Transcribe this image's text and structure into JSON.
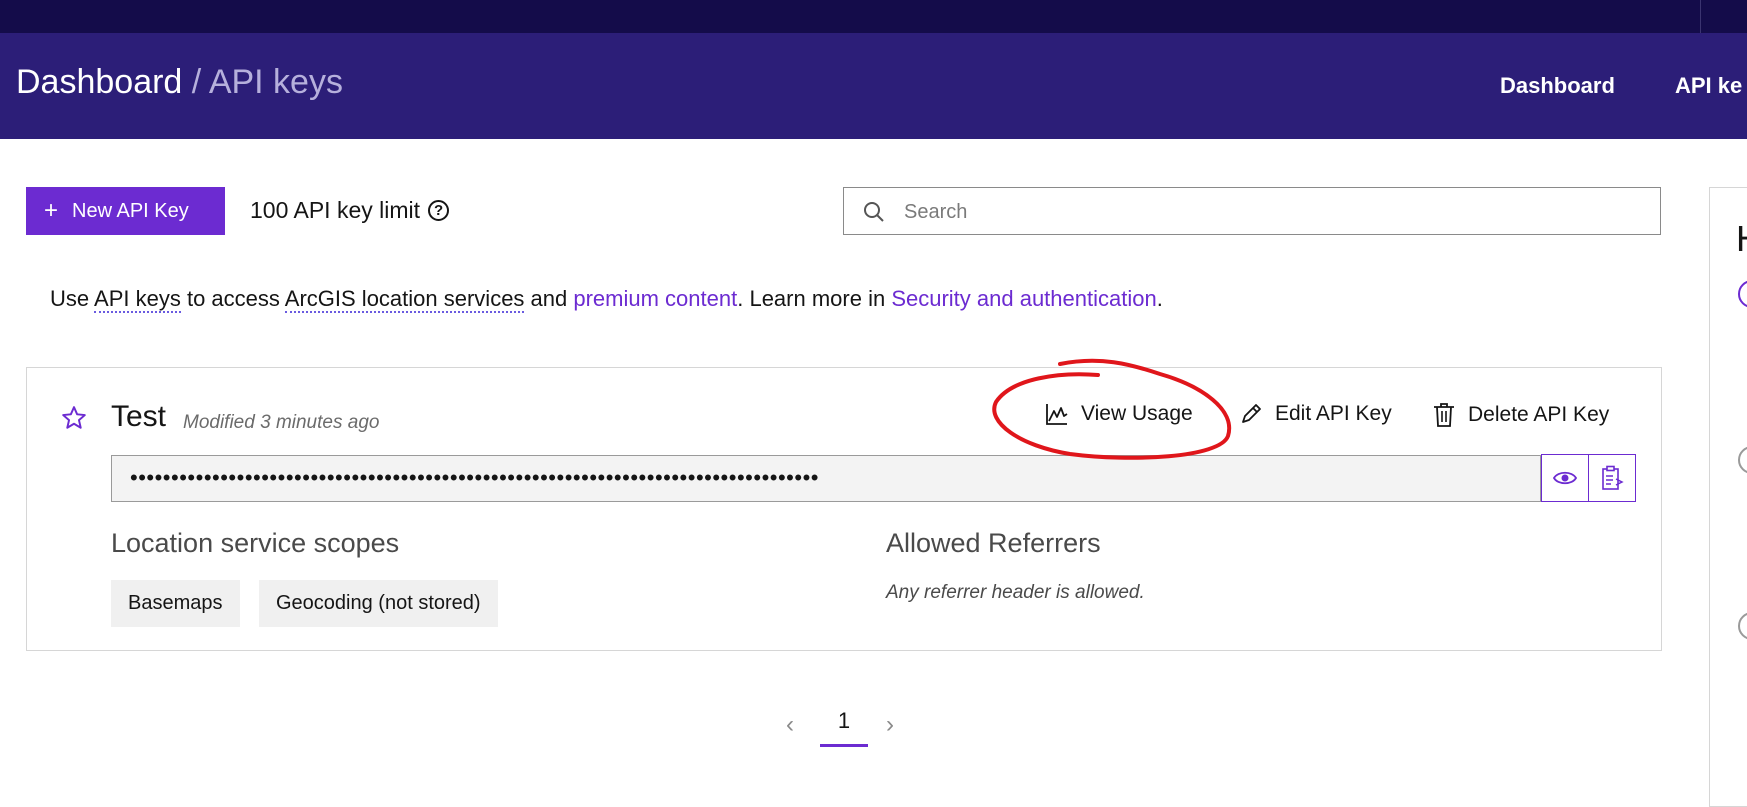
{
  "header": {
    "breadcrumb_root": "Dashboard",
    "breadcrumb_sep": " / ",
    "breadcrumb_current": "API keys",
    "nav": [
      "Dashboard",
      "API ke"
    ]
  },
  "toolbar": {
    "new_key_label": "New API Key",
    "limit_text": "100 API key limit",
    "search_placeholder": "Search"
  },
  "info": {
    "t1": "Use ",
    "link_api_keys": "API keys",
    "t2": " to access ",
    "link_location_services": "ArcGIS location services",
    "t3": " and ",
    "link_premium": "premium content",
    "t4": ". Learn more in ",
    "link_security": "Security and authentication",
    "t5": "."
  },
  "key": {
    "name": "Test",
    "modified": "Modified 3 minutes ago",
    "masked_value": "••••••••••••••••••••••••••••••••••••••••••••••••••••••••••••••••••••••••••••••••••••",
    "actions": {
      "view_usage": "View Usage",
      "edit": "Edit API Key",
      "delete": "Delete API Key"
    },
    "scopes_title": "Location service scopes",
    "scopes": [
      "Basemaps",
      "Geocoding (not stored)"
    ],
    "referrers_title": "Allowed Referrers",
    "referrers_note": "Any referrer header is allowed."
  },
  "pagination": {
    "current": "1",
    "prev": "‹",
    "next": "›"
  },
  "side_panel": {
    "heading_fragment": "H"
  },
  "colors": {
    "topbar": "#140c4a",
    "header": "#2c1e78",
    "accent": "#6c2bd1",
    "annotation": "#e0161b"
  }
}
